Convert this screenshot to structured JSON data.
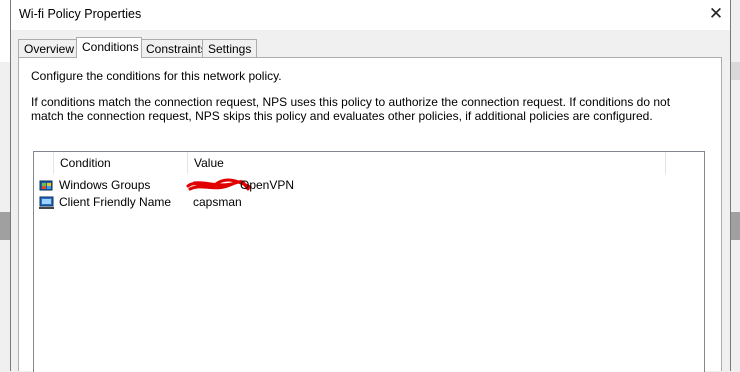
{
  "window": {
    "title": "Wi-fi Policy Properties",
    "close_glyph": "✕"
  },
  "tabs": [
    {
      "label": "Overview",
      "active": false
    },
    {
      "label": "Conditions",
      "active": true
    },
    {
      "label": "Constraints",
      "active": false
    },
    {
      "label": "Settings",
      "active": false
    }
  ],
  "panel": {
    "intro": "Configure the conditions for this network policy.",
    "description": "If conditions match the connection request, NPS uses this policy to authorize the connection request. If conditions do not match the connection request, NPS skips this policy and evaluates other policies, if additional policies are configured."
  },
  "conditions_table": {
    "columns": [
      "Condition",
      "Value"
    ],
    "rows": [
      {
        "icon": "windows-groups-icon",
        "condition": "Windows Groups",
        "value": "OpenVPN",
        "redacted_prefix": true
      },
      {
        "icon": "client-friendly-name-icon",
        "condition": "Client Friendly Name",
        "value": "capsman",
        "redacted_prefix": false
      }
    ]
  },
  "colors": {
    "redaction": "#e00000",
    "window_bg": "#f0f0f0",
    "panel_bg": "#ffffff"
  }
}
